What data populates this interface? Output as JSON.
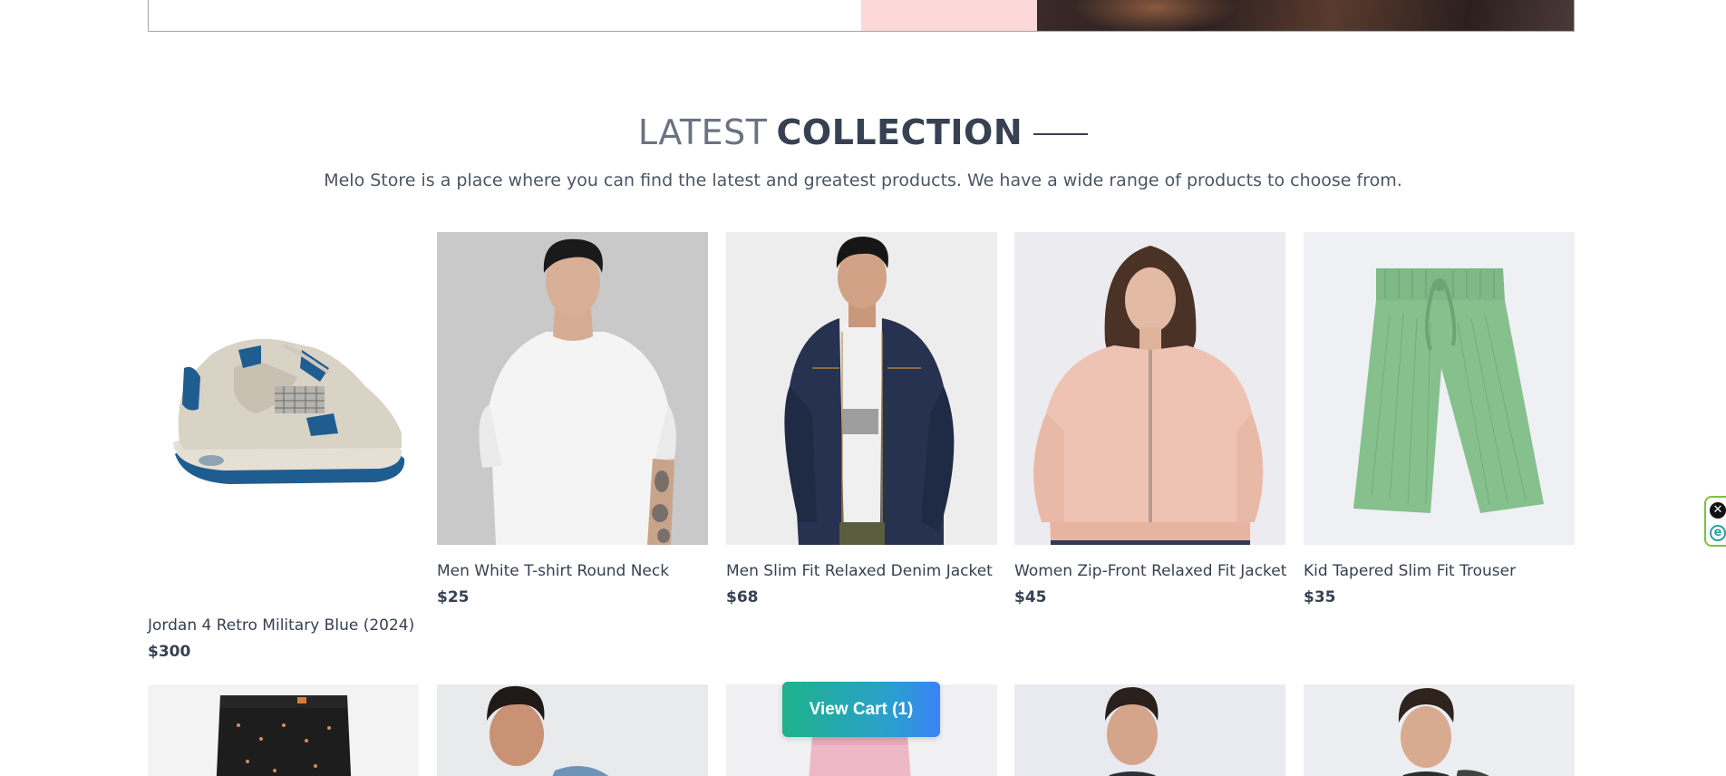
{
  "section": {
    "title_light": "LATEST",
    "title_bold": "COLLECTION",
    "subtitle": "Melo Store is a place where you can find the latest and greatest products. We have a wide range of products to choose from."
  },
  "products": [
    {
      "name": "Jordan 4 Retro Military Blue (2024)",
      "price": "$300"
    },
    {
      "name": "Men White T-shirt Round Neck",
      "price": "$25"
    },
    {
      "name": "Men Slim Fit Relaxed Denim Jacket",
      "price": "$68"
    },
    {
      "name": "Women Zip-Front Relaxed Fit Jacket",
      "price": "$45"
    },
    {
      "name": "Kid Tapered Slim Fit Trouser",
      "price": "$35"
    }
  ],
  "cart": {
    "button_label": "View Cart (1)"
  },
  "widget": {
    "close_icon": "close-icon",
    "extension_icon": "e-icon",
    "close_glyph": "✕",
    "ext_glyph": "e"
  }
}
